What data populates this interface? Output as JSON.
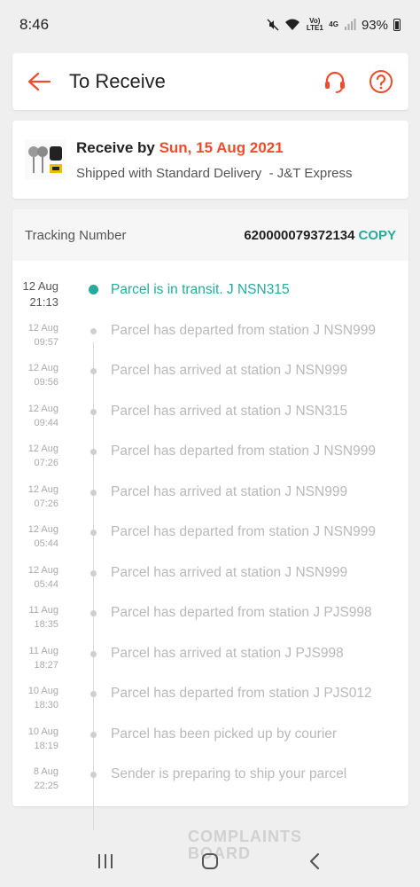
{
  "status_bar": {
    "time": "8:46",
    "network": "4G",
    "lte": "Vo) LTE1",
    "battery": "93%"
  },
  "header": {
    "title": "To Receive"
  },
  "delivery": {
    "receive_by_prefix": "Receive by",
    "receive_by_date": "Sun, 15 Aug 2021",
    "shipping": "Shipped with Standard Delivery  - J&T Express"
  },
  "tracking": {
    "label": "Tracking Number",
    "number": "620000079372134",
    "copy_label": "COPY",
    "events": [
      {
        "date": "12 Aug",
        "time": "21:13",
        "text": "Parcel is in transit. J NSN315"
      },
      {
        "date": "12 Aug",
        "time": "09:57",
        "text": "Parcel has departed from station J NSN999"
      },
      {
        "date": "12 Aug",
        "time": "09:56",
        "text": "Parcel has arrived at station J NSN999"
      },
      {
        "date": "12 Aug",
        "time": "09:44",
        "text": "Parcel has arrived at station J NSN315"
      },
      {
        "date": "12 Aug",
        "time": "07:26",
        "text": "Parcel has departed from station J NSN999"
      },
      {
        "date": "12 Aug",
        "time": "07:26",
        "text": "Parcel has arrived at station J NSN999"
      },
      {
        "date": "12 Aug",
        "time": "05:44",
        "text": "Parcel has departed from station J NSN999"
      },
      {
        "date": "12 Aug",
        "time": "05:44",
        "text": "Parcel has arrived at station J NSN999"
      },
      {
        "date": "11 Aug",
        "time": "18:35",
        "text": "Parcel has departed from station J PJS998"
      },
      {
        "date": "11 Aug",
        "time": "18:27",
        "text": "Parcel has arrived at station J PJS998"
      },
      {
        "date": "10 Aug",
        "time": "18:30",
        "text": "Parcel has departed from station J PJS012"
      },
      {
        "date": "10 Aug",
        "time": "18:19",
        "text": "Parcel has been picked up by courier"
      },
      {
        "date": "8 Aug",
        "time": "22:25",
        "text": "Sender is preparing to ship your parcel"
      }
    ]
  },
  "watermark": {
    "line1": "COMPLAINTS",
    "line2": "BOARD"
  },
  "colors": {
    "accent": "#ee4d2d",
    "teal": "#26aa99"
  },
  "icons": [
    "back-arrow-icon",
    "headset-icon",
    "help-icon",
    "recents-icon",
    "home-icon",
    "back-icon"
  ]
}
